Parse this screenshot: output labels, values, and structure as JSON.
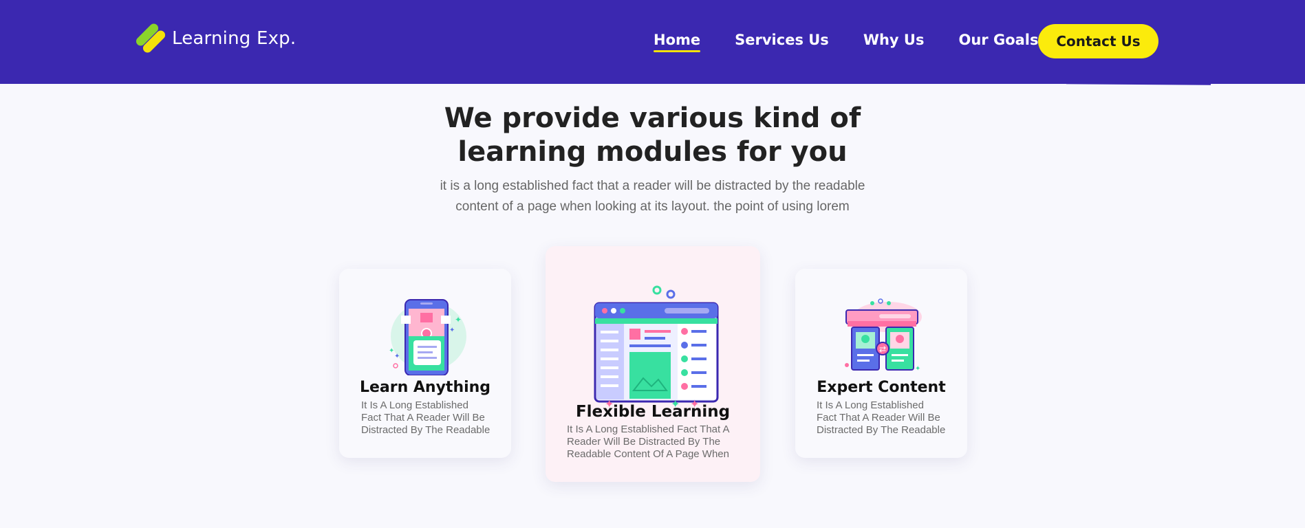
{
  "brand": {
    "name": "Learning Exp."
  },
  "nav": {
    "items": [
      {
        "label": "Home",
        "active": true
      },
      {
        "label": "Services Us",
        "active": false
      },
      {
        "label": "Why Us",
        "active": false
      },
      {
        "label": "Our Goals",
        "active": false
      }
    ],
    "cta_label": "Contact Us"
  },
  "hero": {
    "title_line1": "We provide various kind of",
    "title_line2": "learning modules for you",
    "subtitle_line1": "it is a long established fact that a reader will be distracted by the readable",
    "subtitle_line2": "content of a page when looking at its layout. the point of using lorem"
  },
  "cards": [
    {
      "title": "Learn Anything",
      "desc_lines": [
        "It Is A Long Established",
        "Fact That A Reader Will Be",
        "Distracted By The Readable"
      ],
      "icon": "mobile-learning-icon"
    },
    {
      "title": "Flexible Learning",
      "desc_lines": [
        "It Is A Long Established Fact That A",
        "Reader Will Be Distracted By The",
        "Readable Content Of A Page When"
      ],
      "icon": "browser-dashboard-icon"
    },
    {
      "title": "Expert Content",
      "desc_lines": [
        "It Is A Long Established",
        "Fact That A Reader Will Be",
        "Distracted By The Readable"
      ],
      "icon": "content-exchange-icon"
    }
  ],
  "colors": {
    "header_bg": "#3b28b0",
    "cta_bg": "#fbeb0c",
    "accent_green": "#8bd32a",
    "accent_yellow": "#f4e20a",
    "page_bg": "#f8f8fd",
    "highlight_card_bg": "#fdf1f6"
  }
}
